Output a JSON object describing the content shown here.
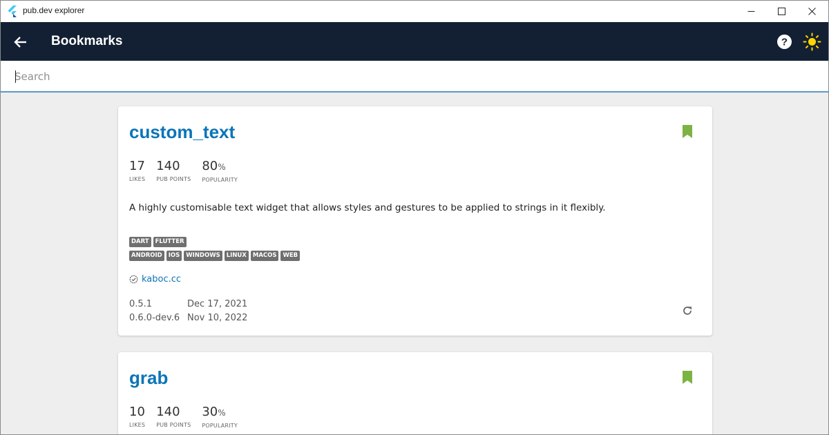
{
  "window": {
    "title": "pub.dev explorer"
  },
  "appbar": {
    "title": "Bookmarks"
  },
  "search": {
    "placeholder": "Search",
    "value": ""
  },
  "colors": {
    "accent": "#0b74b8",
    "appbar": "#132033",
    "bookmark": "#7cb342",
    "sun": "#ffd600"
  },
  "packages": [
    {
      "name": "custom_text",
      "likes": "17",
      "pub_points": "140",
      "popularity": "80",
      "popularity_unit": "%",
      "likes_label": "LIKES",
      "pub_points_label": "PUB POINTS",
      "popularity_label": "POPULARITY",
      "description": "A highly customisable text widget that allows styles and gestures to be applied to strings in it flexibly.",
      "sdk_tags": [
        "DART",
        "FLUTTER"
      ],
      "platform_tags": [
        "ANDROID",
        "IOS",
        "WINDOWS",
        "LINUX",
        "MACOS",
        "WEB"
      ],
      "publisher": "kaboc.cc",
      "versions": [
        {
          "version": "0.5.1",
          "date": "Dec 17, 2021"
        },
        {
          "version": "0.6.0-dev.6",
          "date": "Nov 10, 2022"
        }
      ],
      "bookmarked": true
    },
    {
      "name": "grab",
      "likes": "10",
      "pub_points": "140",
      "popularity": "30",
      "popularity_unit": "%",
      "likes_label": "LIKES",
      "pub_points_label": "PUB POINTS",
      "popularity_label": "POPULARITY",
      "bookmarked": true
    }
  ]
}
